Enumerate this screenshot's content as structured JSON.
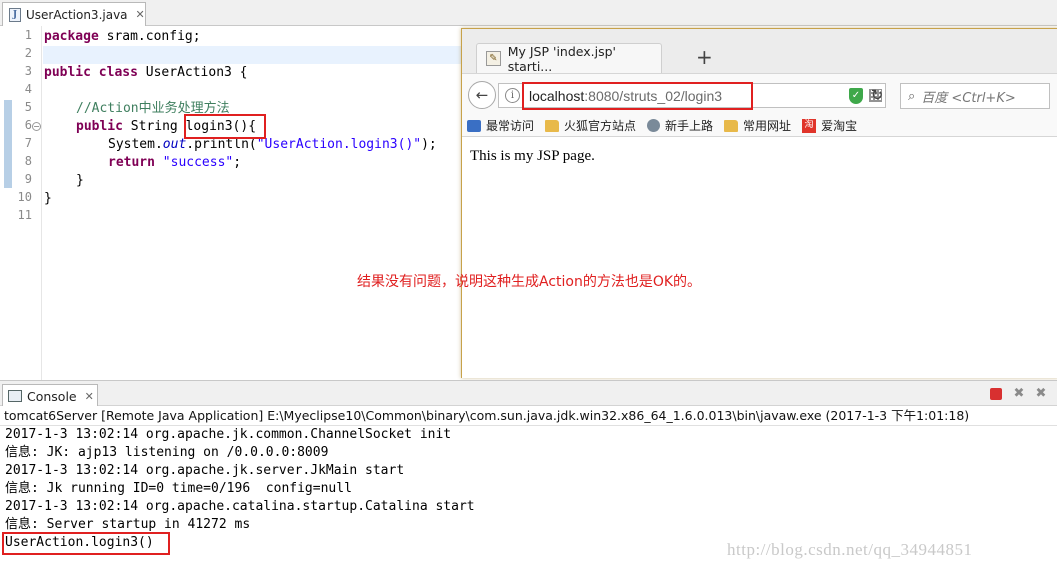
{
  "editor": {
    "tab_label": "UserAction3.java",
    "file_icon_glyph": "J",
    "close_glyph": "✕",
    "line_numbers": [
      "1",
      "2",
      "3",
      "4",
      "5",
      "6",
      "7",
      "8",
      "9",
      "10",
      "11"
    ],
    "code": {
      "l1_kw": "package",
      "l1_rest": " sram.config;",
      "l3_kw1": "public",
      "l3_kw2": "class",
      "l3_rest": " UserAction3 {",
      "l5_comment": "//Action中业务处理方法",
      "l6_kw": "public",
      "l6_type": " String ",
      "l6_method": "login3(){",
      "l7_pre": "System.",
      "l7_field": "out",
      "l7_mid": ".println(",
      "l7_str": "\"UserAction.login3()\"",
      "l7_end": ");",
      "l8_kw": "return",
      "l8_str": "\"success\"",
      "l8_end": ";",
      "l9": "}",
      "l10": "}"
    }
  },
  "browser": {
    "tab_title": "My JSP 'index.jsp' starti...",
    "new_tab_glyph": "+",
    "back_glyph": "←",
    "info_glyph": "i",
    "url_host": "localhost",
    "url_rest": ":8080/struts_02/login3",
    "reload_glyph": "↻",
    "search_glyph": "⌕",
    "search_placeholder": "百度 <Ctrl+K>",
    "bookmarks": [
      "最常访问",
      "火狐官方站点",
      "新手上路",
      "常用网址",
      "爱淘宝"
    ],
    "taobao_glyph": "淘",
    "page_text": "This is my JSP page."
  },
  "annotation": "结果没有问题，说明这种生成Action的方法也是OK的。",
  "console": {
    "tab_label": "Console",
    "close_glyph": "✕",
    "remove_glyph": "✖",
    "remove_all_glyph": "✖",
    "header": "tomcat6Server [Remote Java Application] E:\\Myeclipse10\\Common\\binary\\com.sun.java.jdk.win32.x86_64_1.6.0.013\\bin\\javaw.exe (2017-1-3 下午1:01:18)",
    "lines": [
      "2017-1-3 13:02:14 org.apache.jk.common.ChannelSocket init",
      "信息: JK: ajp13 listening on /0.0.0.0:8009",
      "2017-1-3 13:02:14 org.apache.jk.server.JkMain start",
      "信息: Jk running ID=0 time=0/196  config=null",
      "2017-1-3 13:02:14 org.apache.catalina.startup.Catalina start",
      "信息: Server startup in 41272 ms",
      "UserAction.login3()"
    ]
  },
  "watermark": "http://blog.csdn.net/qq_34944851",
  "colors": {
    "highlight_box": "#e02020",
    "keyword": "#7f0055",
    "comment": "#3f7f5f",
    "string": "#2a00ff"
  }
}
